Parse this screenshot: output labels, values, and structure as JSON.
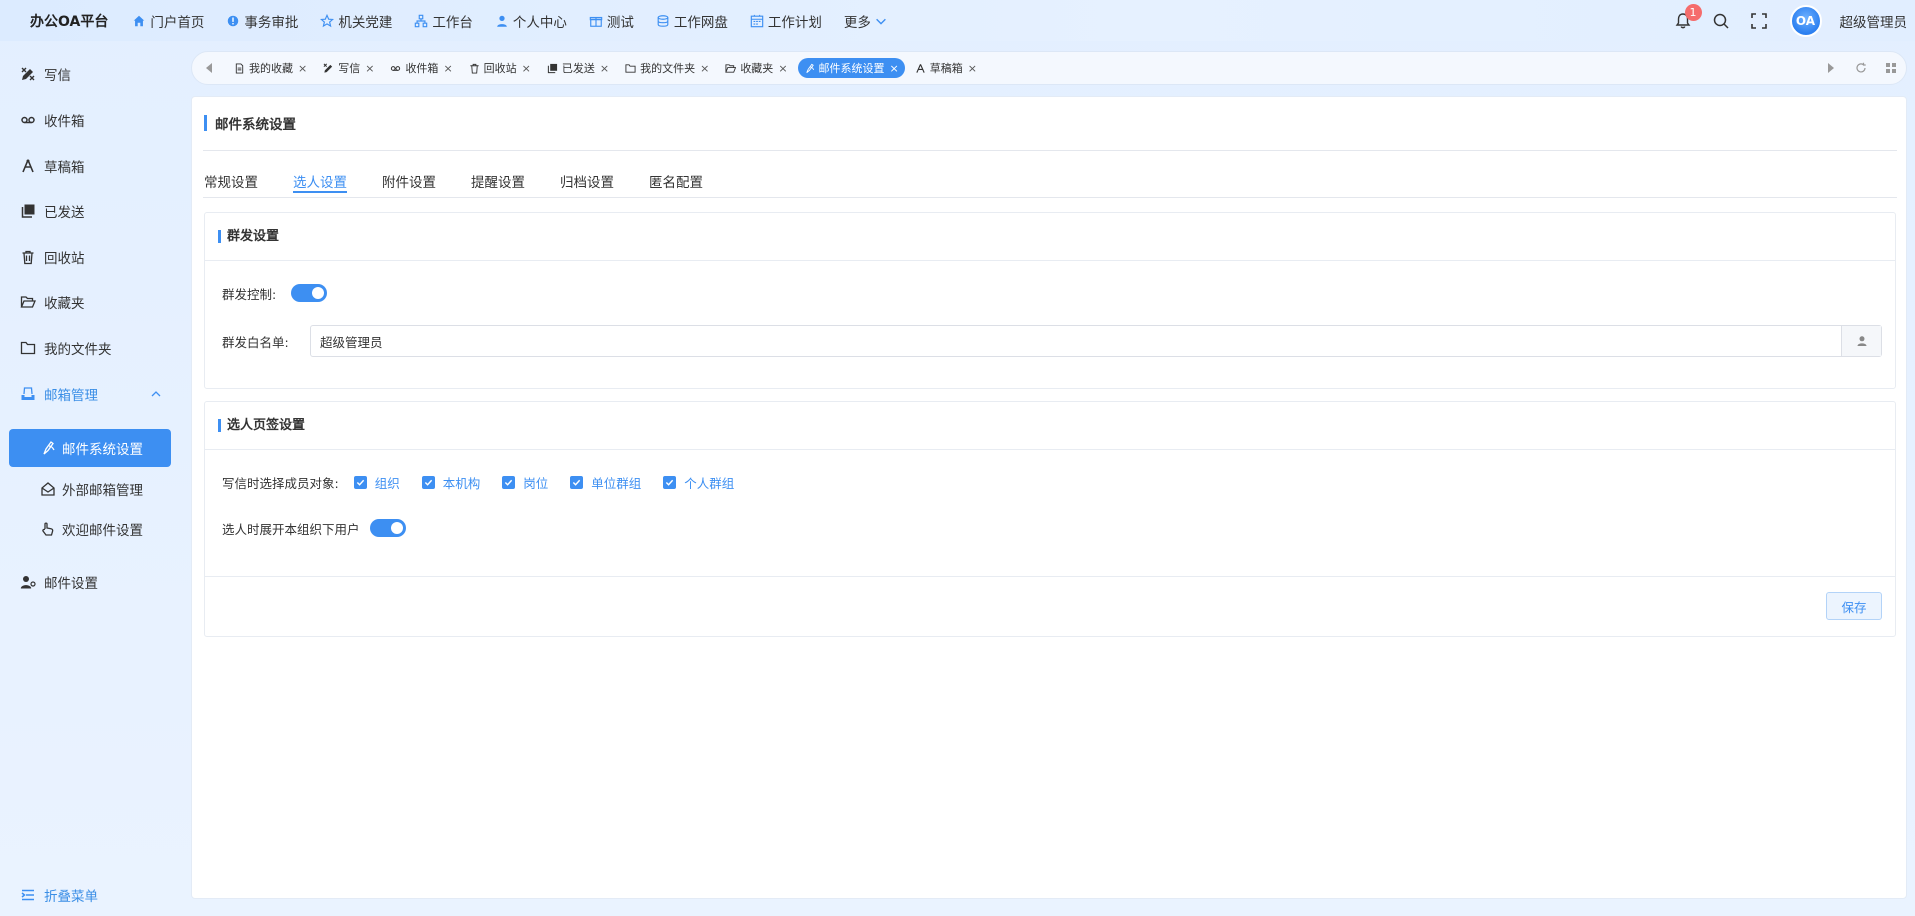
{
  "header": {
    "brand": "办公OA平台",
    "nav": [
      {
        "label": "门户首页",
        "icon": "home-icon"
      },
      {
        "label": "事务审批",
        "icon": "approval-icon"
      },
      {
        "label": "机关党建",
        "icon": "star-icon"
      },
      {
        "label": "工作台",
        "icon": "workbench-icon"
      },
      {
        "label": "个人中心",
        "icon": "user-icon"
      },
      {
        "label": "测试",
        "icon": "gift-icon"
      },
      {
        "label": "工作网盘",
        "icon": "database-icon"
      },
      {
        "label": "工作计划",
        "icon": "calendar-icon"
      },
      {
        "label": "更多",
        "icon": "chevron-down-icon"
      }
    ],
    "notification_count": "1",
    "avatar_text": "OA",
    "username": "超级管理员"
  },
  "sidebar": {
    "items": [
      {
        "label": "写信",
        "icon": "write-icon"
      },
      {
        "label": "收件箱",
        "icon": "inbox-icon"
      },
      {
        "label": "草稿箱",
        "icon": "draft-icon"
      },
      {
        "label": "已发送",
        "icon": "sent-icon"
      },
      {
        "label": "回收站",
        "icon": "trash-icon"
      },
      {
        "label": "收藏夹",
        "icon": "folder-open-icon"
      },
      {
        "label": "我的文件夹",
        "icon": "folder-icon"
      }
    ],
    "group": {
      "label": "邮箱管理",
      "icon": "mailbox-manage-icon",
      "expanded": true,
      "children": [
        {
          "label": "邮件系统设置",
          "icon": "mail-setting-icon",
          "active": true
        },
        {
          "label": "外部邮箱管理",
          "icon": "external-mail-icon"
        },
        {
          "label": "欢迎邮件设置",
          "icon": "welcome-mail-icon"
        }
      ]
    },
    "mail_settings": {
      "label": "邮件设置",
      "icon": "user-setting-icon"
    },
    "collapse_label": "折叠菜单"
  },
  "tabs": [
    {
      "label": "我的收藏",
      "icon": "doc-icon"
    },
    {
      "label": "写信",
      "icon": "write-icon"
    },
    {
      "label": "收件箱",
      "icon": "inbox-icon"
    },
    {
      "label": "回收站",
      "icon": "trash-icon"
    },
    {
      "label": "已发送",
      "icon": "sent-icon"
    },
    {
      "label": "我的文件夹",
      "icon": "folder-icon"
    },
    {
      "label": "收藏夹",
      "icon": "folder-open-icon"
    },
    {
      "label": "邮件系统设置",
      "icon": "mail-setting-icon",
      "active": true
    },
    {
      "label": "草稿箱",
      "icon": "draft-icon"
    }
  ],
  "tab_close": "×",
  "page": {
    "title": "邮件系统设置",
    "subtabs": [
      {
        "label": "常规设置"
      },
      {
        "label": "选人设置",
        "active": true
      },
      {
        "label": "附件设置"
      },
      {
        "label": "提醒设置"
      },
      {
        "label": "归档设置"
      },
      {
        "label": "匿名配置"
      }
    ],
    "group_send": {
      "title": "群发设置",
      "control_label": "群发控制:",
      "control_on": true,
      "whitelist_label": "群发白名单:",
      "whitelist_value": "超级管理员"
    },
    "picker": {
      "title": "选人页签设置",
      "objects_label": "写信时选择成员对象:",
      "options": [
        {
          "label": "组织",
          "checked": true
        },
        {
          "label": "本机构",
          "checked": true
        },
        {
          "label": "岗位",
          "checked": true
        },
        {
          "label": "单位群组",
          "checked": true
        },
        {
          "label": "个人群组",
          "checked": true
        }
      ],
      "expand_label": "选人时展开本组织下用户",
      "expand_on": true,
      "save_label": "保存"
    }
  },
  "colors": {
    "accent": "#3d8ff2",
    "badge": "#f56c6c"
  }
}
